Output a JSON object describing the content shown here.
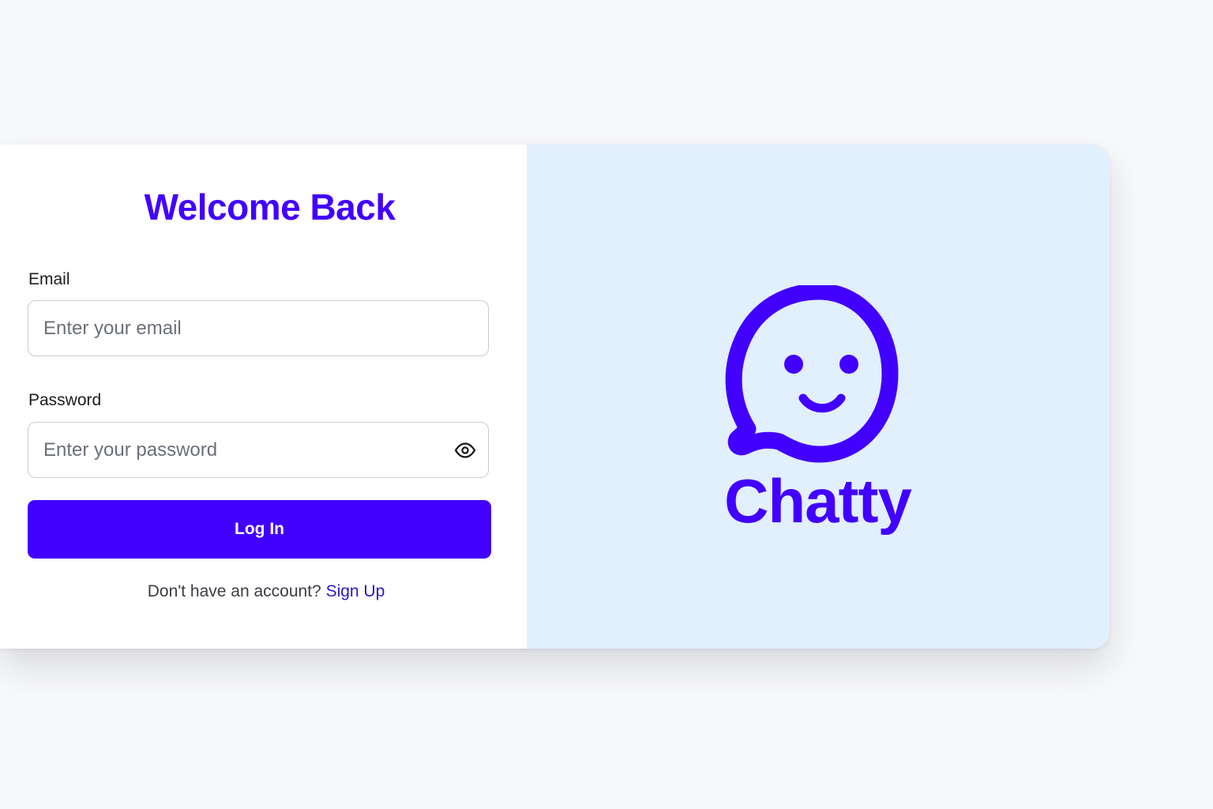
{
  "login": {
    "title": "Welcome Back",
    "email_label": "Email",
    "email_placeholder": "Enter your email",
    "password_label": "Password",
    "password_placeholder": "Enter your password",
    "submit_label": "Log In",
    "signup_prompt": "Don't have an account?",
    "signup_link": "Sign Up"
  },
  "brand": {
    "name": "Chatty",
    "icon": "smiley-chat-bubble-icon"
  },
  "colors": {
    "accent": "#4200ff",
    "panel_bg": "#e2effd",
    "page_bg": "#f8f9fb",
    "link": "#2a18c8"
  }
}
